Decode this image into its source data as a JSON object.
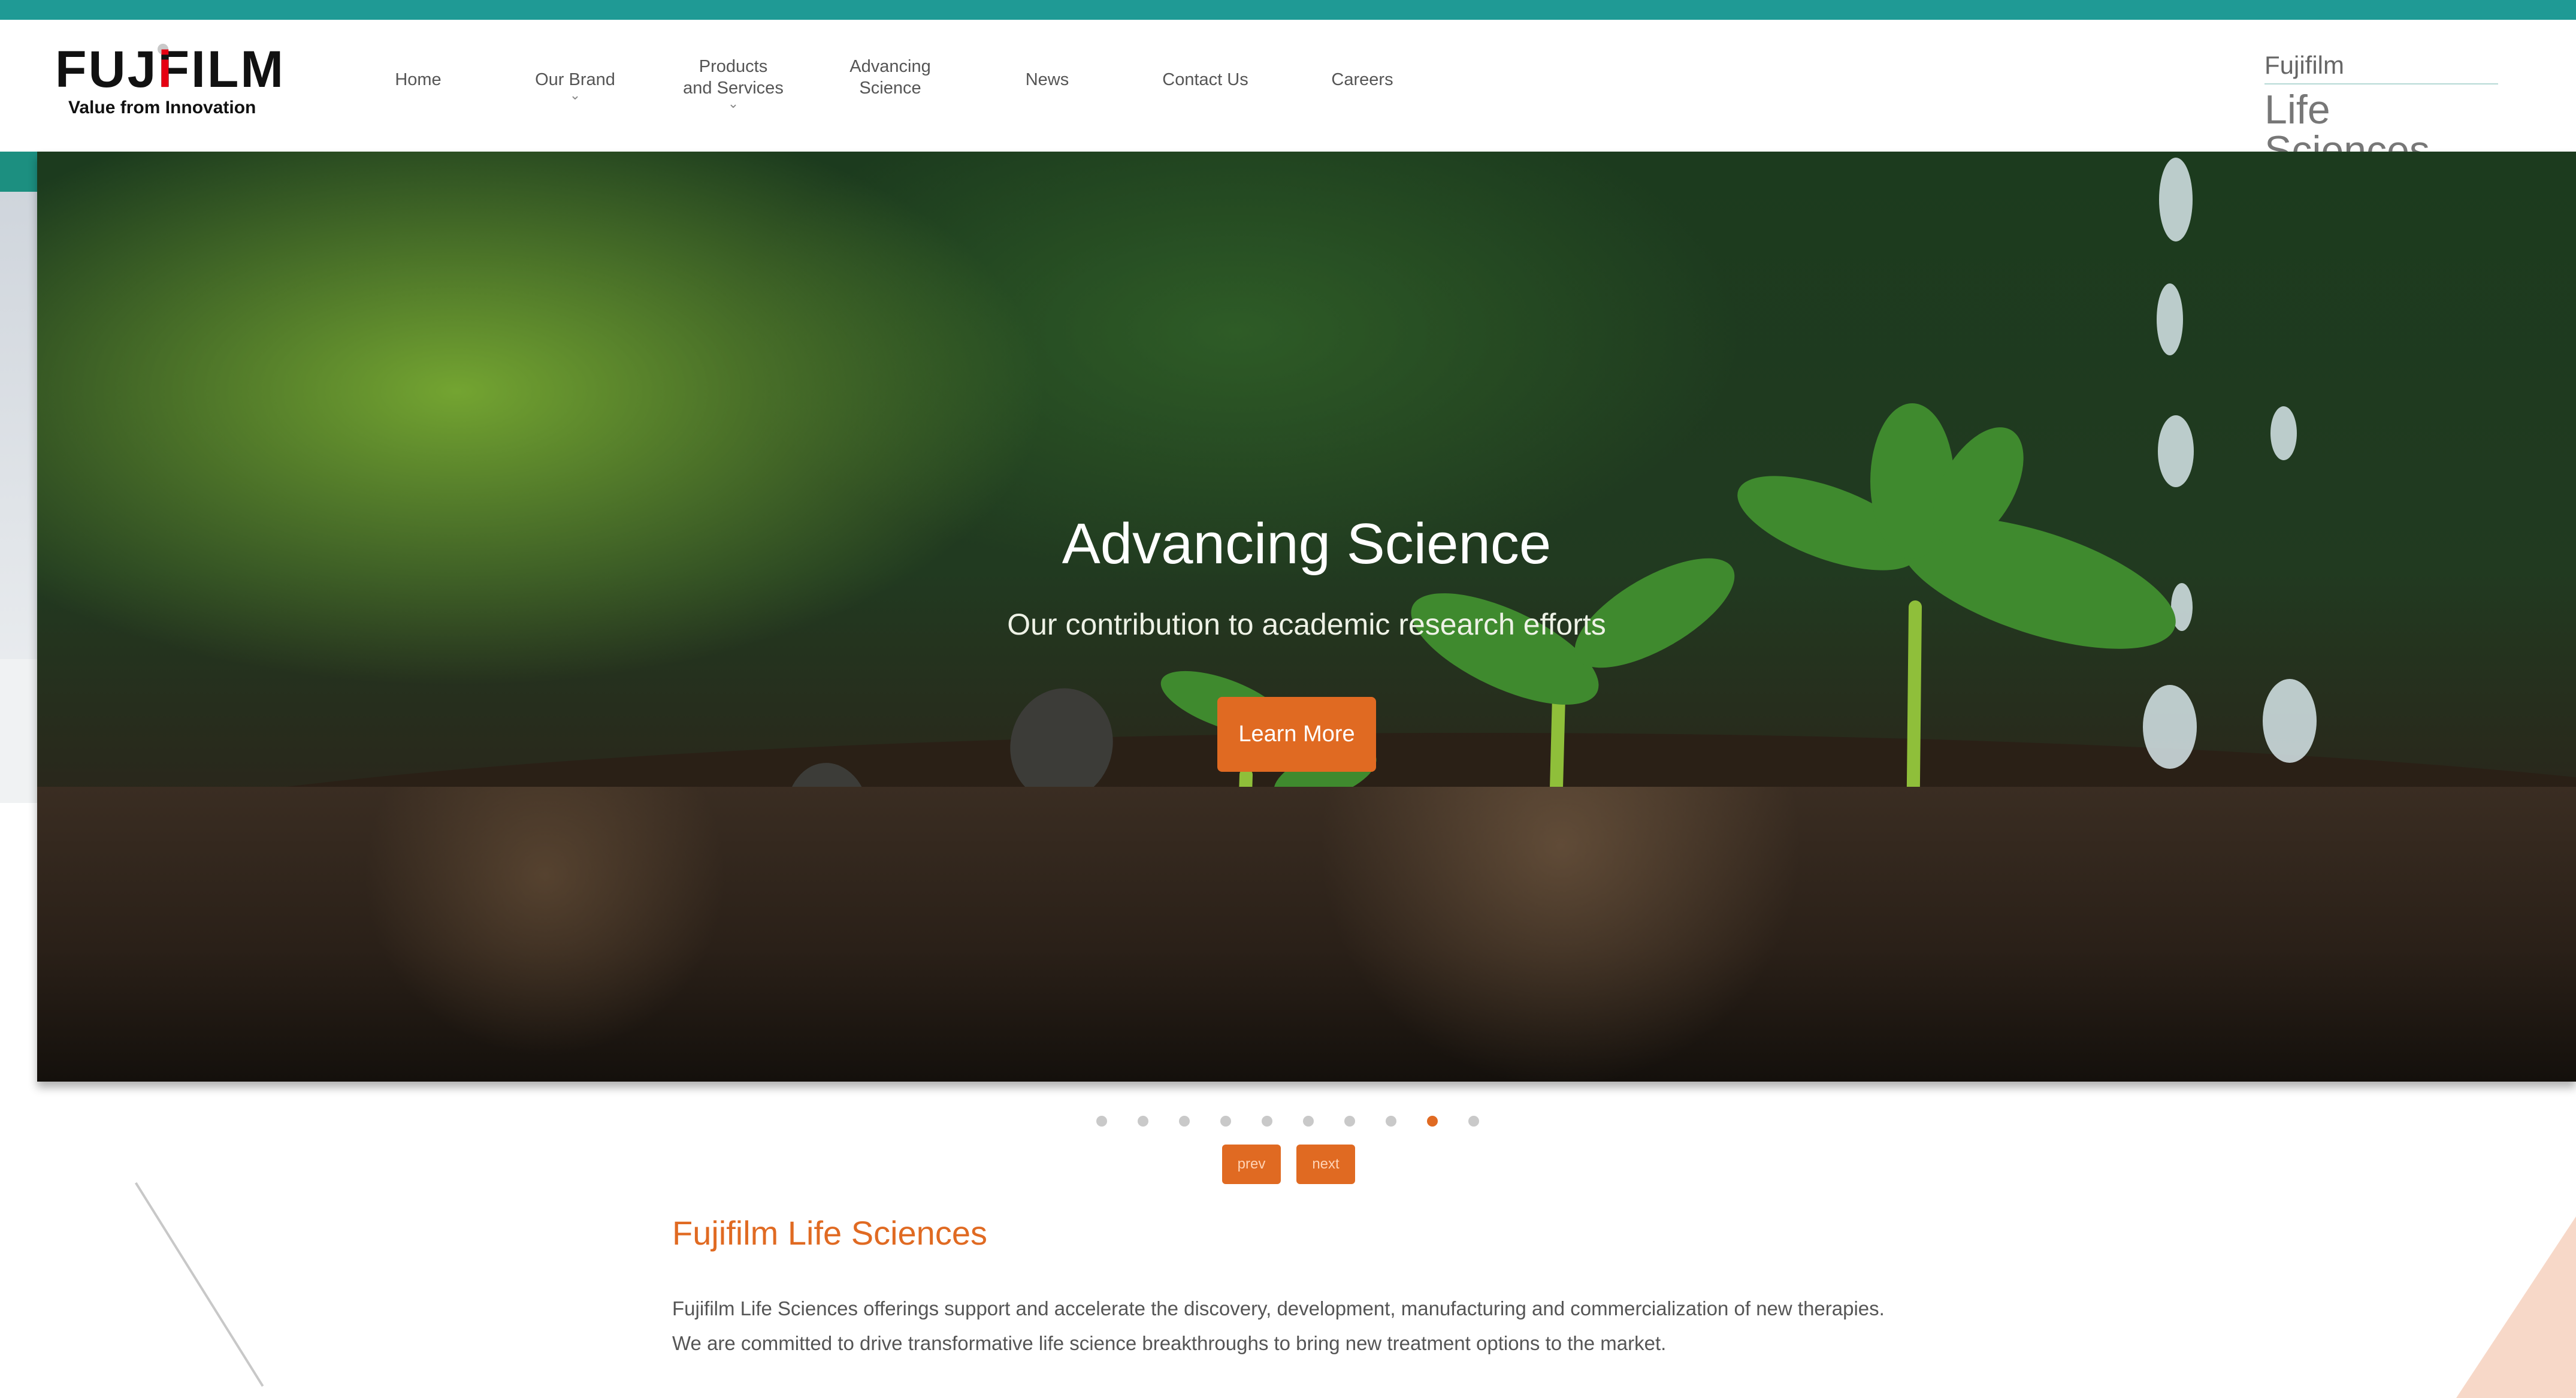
{
  "brand": {
    "logo_text_a": "FUJ",
    "logo_text_b": "i",
    "logo_text_c": "FILM",
    "tagline": "Value from Innovation",
    "right_small": "Fujifilm",
    "right_big": "Life Sciences"
  },
  "nav": [
    {
      "line1": "Home",
      "line2": "",
      "dropdown": false
    },
    {
      "line1": "Our Brand",
      "line2": "",
      "dropdown": true
    },
    {
      "line1": "Products",
      "line2": "and Services",
      "dropdown": true
    },
    {
      "line1": "Advancing",
      "line2": "Science",
      "dropdown": false
    },
    {
      "line1": "News",
      "line2": "",
      "dropdown": false
    },
    {
      "line1": "Contact Us",
      "line2": "",
      "dropdown": false
    },
    {
      "line1": "Careers",
      "line2": "",
      "dropdown": false
    }
  ],
  "hero": {
    "title": "Advancing Science",
    "subtitle": "Our contribution to academic research efforts",
    "button_label": "Learn More"
  },
  "carousel": {
    "slide_count": 10,
    "active_index": 8,
    "prev_label": "prev",
    "next_label": "next"
  },
  "section": {
    "title": "Fujifilm Life Sciences",
    "body": "Fujifilm Life Sciences offerings support and accelerate the discovery, development, manufacturing and commercialization of new therapies. We are committed to drive transformative life science breakthroughs to bring new treatment options to the market."
  },
  "colors": {
    "accent_orange": "#e06a22",
    "top_bar_teal": "#1f9a95",
    "logo_red": "#e60012"
  }
}
